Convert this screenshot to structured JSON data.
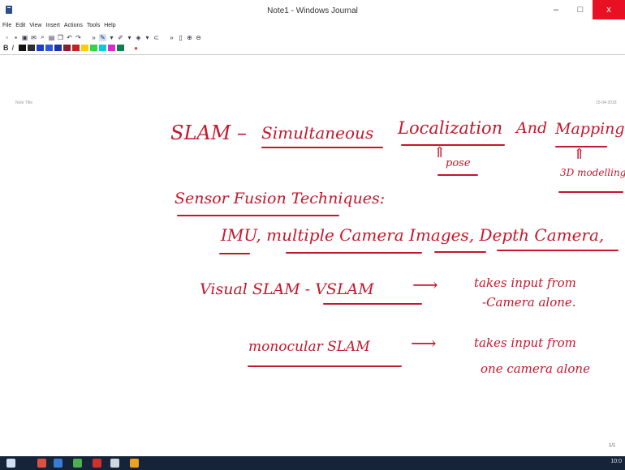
{
  "window": {
    "title": "Note1 - Windows Journal",
    "minimize_label": "–",
    "maximize_label": "□",
    "close_label": "x"
  },
  "menu": [
    "File",
    "Edit",
    "View",
    "Insert",
    "Actions",
    "Tools",
    "Help"
  ],
  "toolbar": {
    "bold_label": "B",
    "italic_label": "I",
    "palette": [
      "#111111",
      "#2e2e2e",
      "#1f3fbf",
      "#2a59d6",
      "#1836a0",
      "#8c1c2f",
      "#c81d25",
      "#f5d100",
      "#37d34a",
      "#12c5d9",
      "#d12dd1",
      "#0f7c53"
    ]
  },
  "page": {
    "title_label": "Note Title",
    "date": "15-04-2018",
    "page_number": "1/1"
  },
  "ink_color": "#c4172b",
  "notes": {
    "line1_slam": "SLAM –",
    "line1_simul": "Simultaneous",
    "line1_local": "Localization",
    "line1_and": "And",
    "line1_mapping": "Mapping",
    "ann_pose": "pose",
    "ann_3d": "3D modelling",
    "sensor_fusion": "Sensor Fusion Techniques:",
    "sensor_list": "IMU, multiple Camera Images, Depth Camera,",
    "visual_slam": "Visual SLAM - VSLAM",
    "takes_input_1": "takes input from",
    "camera_alone": "-Camera alone.",
    "monocular": "monocular SLAM",
    "takes_input_2": "takes input from",
    "one_camera": "one camera alone"
  },
  "taskbar": {
    "tray_time": "10:0"
  }
}
